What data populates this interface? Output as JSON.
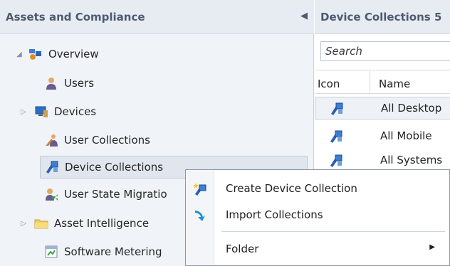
{
  "left_pane": {
    "title": "Assets and Compliance",
    "collapse_icon": "chevron-left-icon",
    "tree": [
      {
        "label": "Overview",
        "icon": "overview-icon",
        "expander": "expanded"
      },
      {
        "label": "Users",
        "icon": "users-icon",
        "expander": "none"
      },
      {
        "label": "Devices",
        "icon": "devices-icon",
        "expander": "collapsed"
      },
      {
        "label": "User Collections",
        "icon": "user-collections-icon",
        "expander": "none"
      },
      {
        "label": "Device Collections",
        "icon": "device-collections-icon",
        "expander": "none",
        "selected": true
      },
      {
        "label": "User State Migratio",
        "icon": "user-state-migration-icon",
        "expander": "none"
      },
      {
        "label": "Asset Intelligence",
        "icon": "folder-icon",
        "expander": "collapsed"
      },
      {
        "label": "Software Metering",
        "icon": "software-metering-icon",
        "expander": "none"
      }
    ]
  },
  "right_pane": {
    "title": "Device Collections 5",
    "search_placeholder": "Search",
    "columns": [
      "Icon",
      "Name"
    ],
    "rows": [
      {
        "name": "All Desktop",
        "icon": "device-collection-icon"
      },
      {
        "name": "All Mobile",
        "icon": "device-collection-icon"
      },
      {
        "name": "All Systems",
        "icon": "device-collection-icon"
      }
    ]
  },
  "context_menu": {
    "items": [
      {
        "label": "Create Device Collection",
        "icon": "create-collection-icon"
      },
      {
        "label": "Import Collections",
        "icon": "import-arrow-icon"
      },
      {
        "label": "Folder",
        "icon": "none",
        "submenu": true
      }
    ]
  },
  "colors": {
    "pane_background": "#f0f3f8",
    "header_background": "#e7ecf3",
    "header_text": "#4e5b6e",
    "selection_background": "#e1e6ee"
  }
}
